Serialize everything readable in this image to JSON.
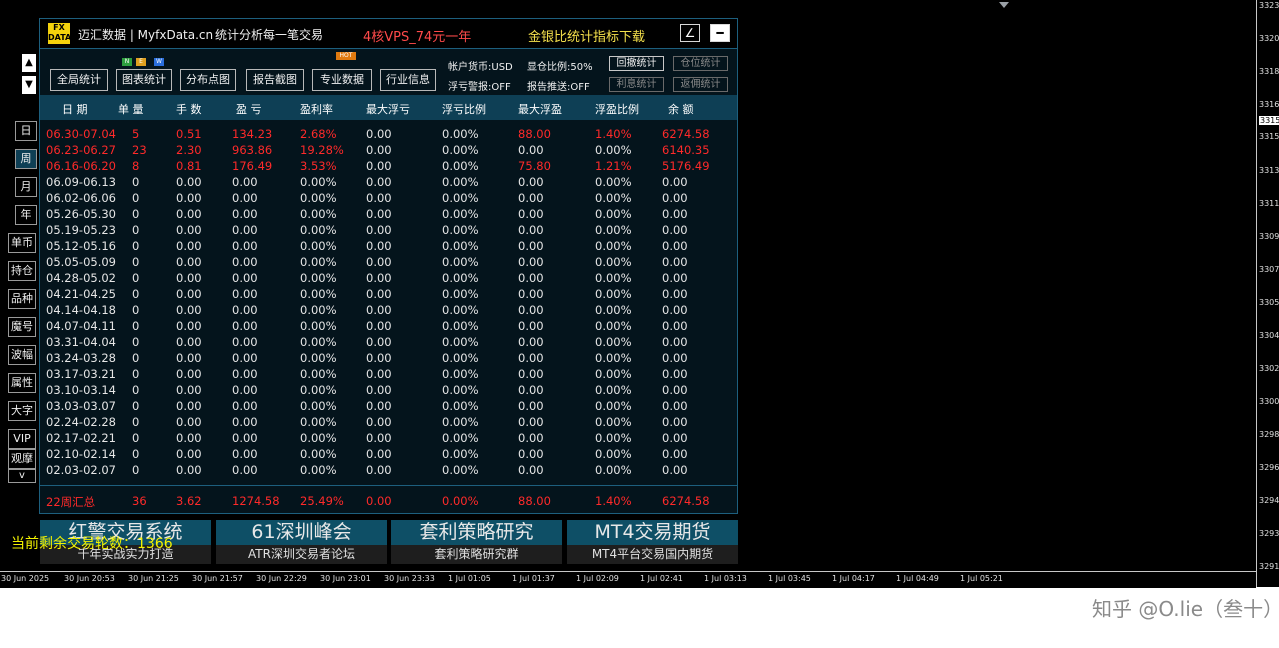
{
  "header": {
    "logo_text": "FX DATA",
    "brand": "迈汇数据 | MyfxData.cn",
    "slogan": "统计分析每一笔交易",
    "promo_vps": "4核VPS_74元一年",
    "promo_download": "金银比统计指标下载",
    "edit_icon_glyph": "∠",
    "minimize_glyph": "━"
  },
  "nav_buttons": [
    "全局统计",
    "图表统计",
    "分布点图",
    "报告截图",
    "专业数据",
    "行业信息"
  ],
  "badges": {
    "n": "N",
    "e": "E",
    "w": "W",
    "hot": "HOT"
  },
  "account_info": {
    "currency": "帐户货币:USD",
    "ratio": "显仓比例:50%",
    "float_alert": "浮亏警报:OFF",
    "report_push": "报告推送:OFF"
  },
  "stat_buttons": {
    "drawdown": "回撤统计",
    "position": "仓位统计",
    "interest": "利息统计",
    "rebate": "返佣统计"
  },
  "columns": [
    "日 期",
    "单 量",
    "手 数",
    "盈 亏",
    "盈利率",
    "最大浮亏",
    "浮亏比例",
    "最大浮盈",
    "浮盈比例",
    "余 额"
  ],
  "rows": [
    [
      "06.30-07.04",
      "5",
      "0.51",
      "134.23",
      "2.68%",
      "0.00",
      "0.00%",
      "88.00",
      "1.40%",
      "6274.58"
    ],
    [
      "06.23-06.27",
      "23",
      "2.30",
      "963.86",
      "19.28%",
      "0.00",
      "0.00%",
      "0.00",
      "0.00%",
      "6140.35"
    ],
    [
      "06.16-06.20",
      "8",
      "0.81",
      "176.49",
      "3.53%",
      "0.00",
      "0.00%",
      "75.80",
      "1.21%",
      "5176.49"
    ],
    [
      "06.09-06.13",
      "0",
      "0.00",
      "0.00",
      "0.00%",
      "0.00",
      "0.00%",
      "0.00",
      "0.00%",
      "0.00"
    ],
    [
      "06.02-06.06",
      "0",
      "0.00",
      "0.00",
      "0.00%",
      "0.00",
      "0.00%",
      "0.00",
      "0.00%",
      "0.00"
    ],
    [
      "05.26-05.30",
      "0",
      "0.00",
      "0.00",
      "0.00%",
      "0.00",
      "0.00%",
      "0.00",
      "0.00%",
      "0.00"
    ],
    [
      "05.19-05.23",
      "0",
      "0.00",
      "0.00",
      "0.00%",
      "0.00",
      "0.00%",
      "0.00",
      "0.00%",
      "0.00"
    ],
    [
      "05.12-05.16",
      "0",
      "0.00",
      "0.00",
      "0.00%",
      "0.00",
      "0.00%",
      "0.00",
      "0.00%",
      "0.00"
    ],
    [
      "05.05-05.09",
      "0",
      "0.00",
      "0.00",
      "0.00%",
      "0.00",
      "0.00%",
      "0.00",
      "0.00%",
      "0.00"
    ],
    [
      "04.28-05.02",
      "0",
      "0.00",
      "0.00",
      "0.00%",
      "0.00",
      "0.00%",
      "0.00",
      "0.00%",
      "0.00"
    ],
    [
      "04.21-04.25",
      "0",
      "0.00",
      "0.00",
      "0.00%",
      "0.00",
      "0.00%",
      "0.00",
      "0.00%",
      "0.00"
    ],
    [
      "04.14-04.18",
      "0",
      "0.00",
      "0.00",
      "0.00%",
      "0.00",
      "0.00%",
      "0.00",
      "0.00%",
      "0.00"
    ],
    [
      "04.07-04.11",
      "0",
      "0.00",
      "0.00",
      "0.00%",
      "0.00",
      "0.00%",
      "0.00",
      "0.00%",
      "0.00"
    ],
    [
      "03.31-04.04",
      "0",
      "0.00",
      "0.00",
      "0.00%",
      "0.00",
      "0.00%",
      "0.00",
      "0.00%",
      "0.00"
    ],
    [
      "03.24-03.28",
      "0",
      "0.00",
      "0.00",
      "0.00%",
      "0.00",
      "0.00%",
      "0.00",
      "0.00%",
      "0.00"
    ],
    [
      "03.17-03.21",
      "0",
      "0.00",
      "0.00",
      "0.00%",
      "0.00",
      "0.00%",
      "0.00",
      "0.00%",
      "0.00"
    ],
    [
      "03.10-03.14",
      "0",
      "0.00",
      "0.00",
      "0.00%",
      "0.00",
      "0.00%",
      "0.00",
      "0.00%",
      "0.00"
    ],
    [
      "03.03-03.07",
      "0",
      "0.00",
      "0.00",
      "0.00%",
      "0.00",
      "0.00%",
      "0.00",
      "0.00%",
      "0.00"
    ],
    [
      "02.24-02.28",
      "0",
      "0.00",
      "0.00",
      "0.00%",
      "0.00",
      "0.00%",
      "0.00",
      "0.00%",
      "0.00"
    ],
    [
      "02.17-02.21",
      "0",
      "0.00",
      "0.00",
      "0.00%",
      "0.00",
      "0.00%",
      "0.00",
      "0.00%",
      "0.00"
    ],
    [
      "02.10-02.14",
      "0",
      "0.00",
      "0.00",
      "0.00%",
      "0.00",
      "0.00%",
      "0.00",
      "0.00%",
      "0.00"
    ],
    [
      "02.03-02.07",
      "0",
      "0.00",
      "0.00",
      "0.00%",
      "0.00",
      "0.00%",
      "0.00",
      "0.00%",
      "0.00"
    ]
  ],
  "highlight_rows": 3,
  "summary": [
    "22周汇总",
    "36",
    "3.62",
    "1274.58",
    "25.49%",
    "0.00",
    "0.00%",
    "88.00",
    "1.40%",
    "6274.58"
  ],
  "side_buttons": [
    "日",
    "周",
    "月",
    "年",
    "单币",
    "持仓",
    "品种",
    "魔号",
    "波幅",
    "属性",
    "大字",
    "VIP",
    "观摩"
  ],
  "side_active": "周",
  "side_chevron": "v",
  "arrows": {
    "up": "▲",
    "down": "▼"
  },
  "banners": [
    {
      "title": "红警交易系统",
      "subtitle": "千年实战实力打造"
    },
    {
      "title": "61深圳峰会",
      "subtitle": "ATR深圳交易者论坛"
    },
    {
      "title": "套利策略研究",
      "subtitle": "套利策略研究群"
    },
    {
      "title": "MT4交易期货",
      "subtitle": "MT4平台交易国内期货"
    }
  ],
  "remaining_text": "当前剩余交易轮数：1366",
  "price_labels": [
    "3323",
    "3320",
    "3318",
    "3316",
    "3315",
    "3315",
    "3313",
    "3311",
    "3309",
    "3307",
    "3305",
    "3304",
    "3302",
    "3300",
    "3298",
    "3296",
    "3294",
    "3293",
    "3291"
  ],
  "current_price_index": 4,
  "time_labels": [
    "30 Jun 2025",
    "30 Jun 20:53",
    "30 Jun 21:25",
    "30 Jun 21:57",
    "30 Jun 22:29",
    "30 Jun 23:01",
    "30 Jun 23:33",
    "1 Jul 01:05",
    "1 Jul 01:37",
    "1 Jul 02:09",
    "1 Jul 02:41",
    "1 Jul 03:13",
    "1 Jul 03:45",
    "1 Jul 04:17",
    "1 Jul 04:49",
    "1 Jul 05:21"
  ],
  "watermark": "知乎 @O.lie（叁十）",
  "colors": {
    "positive_red": "#ff2a2a",
    "normal_text": "#e6e6e6",
    "header_bg": "#0e3f55",
    "panel_bg": "#04141c",
    "promo_red": "#ff4a4a",
    "promo_yellow": "#f4e04c",
    "badge_n": "#2e9e3e",
    "badge_e": "#e0a020",
    "badge_w": "#2a6edc",
    "badge_hot": "#e07a10"
  }
}
